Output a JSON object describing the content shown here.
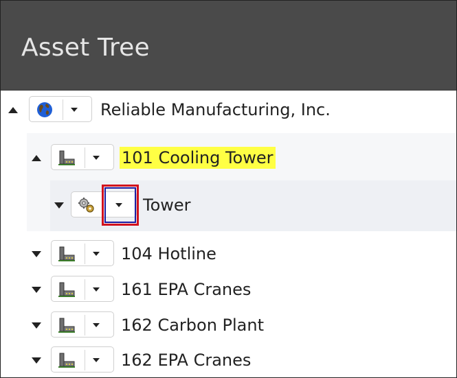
{
  "header": {
    "title": "Asset Tree"
  },
  "tree": {
    "root": {
      "label": "Reliable Manufacturing, Inc.",
      "icon": "globe-icon",
      "expanded": true
    },
    "child": {
      "label": "101 Cooling Tower",
      "icon": "factory-icon",
      "expanded": true,
      "highlighted": true,
      "highlight_color": "#ffff44"
    },
    "grandchild": {
      "label": "Tower",
      "icon": "gears-icon",
      "expanded": false
    },
    "siblings": [
      {
        "label": "104 Hotline",
        "icon": "factory-icon"
      },
      {
        "label": "161 EPA Cranes",
        "icon": "factory-icon"
      },
      {
        "label": "162 Carbon Plant",
        "icon": "factory-icon"
      },
      {
        "label": "162 EPA Cranes",
        "icon": "factory-icon"
      }
    ]
  },
  "annotation": {
    "box_color": "#d2111d"
  }
}
